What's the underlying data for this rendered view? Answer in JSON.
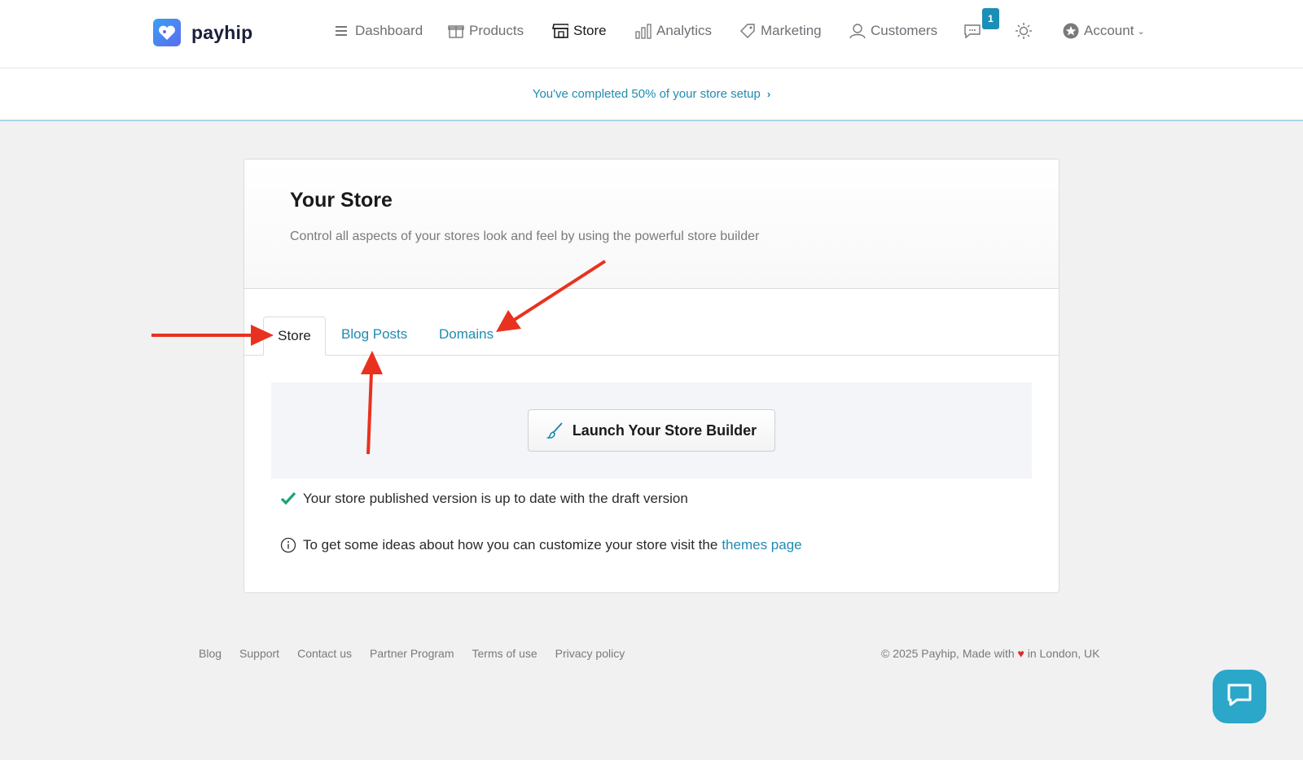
{
  "brand": {
    "name": "payhip"
  },
  "nav": {
    "items": [
      {
        "label": "Dashboard",
        "icon": "menu-icon"
      },
      {
        "label": "Products",
        "icon": "gift-icon"
      },
      {
        "label": "Store",
        "icon": "storefront-icon"
      },
      {
        "label": "Analytics",
        "icon": "bar-chart-icon"
      },
      {
        "label": "Marketing",
        "icon": "tag-icon"
      },
      {
        "label": "Customers",
        "icon": "user-icon"
      }
    ],
    "notifications_count": "1",
    "account_label": "Account"
  },
  "setup_banner": {
    "text": "You've completed 50% of your store setup"
  },
  "card": {
    "title": "Your Store",
    "subtitle": "Control all aspects of your stores look and feel by using the powerful store builder",
    "tabs": [
      "Store",
      "Blog Posts",
      "Domains"
    ],
    "builder_button": "Launch Your Store Builder",
    "status_text": "Your store published version is up to date with the draft version",
    "info_text": "To get some ideas about how you can customize your store visit the",
    "info_link": "themes page"
  },
  "footer": {
    "links": [
      "Blog",
      "Support",
      "Contact us",
      "Partner Program",
      "Terms of use",
      "Privacy policy"
    ],
    "copyright_prefix": "© 2025 Payhip, Made with",
    "heart": "♥",
    "copyright_suffix": "in London, UK"
  },
  "colors": {
    "accent": "#1f8bb0",
    "annotation": "#e8321f",
    "check": "#1aa37a"
  }
}
